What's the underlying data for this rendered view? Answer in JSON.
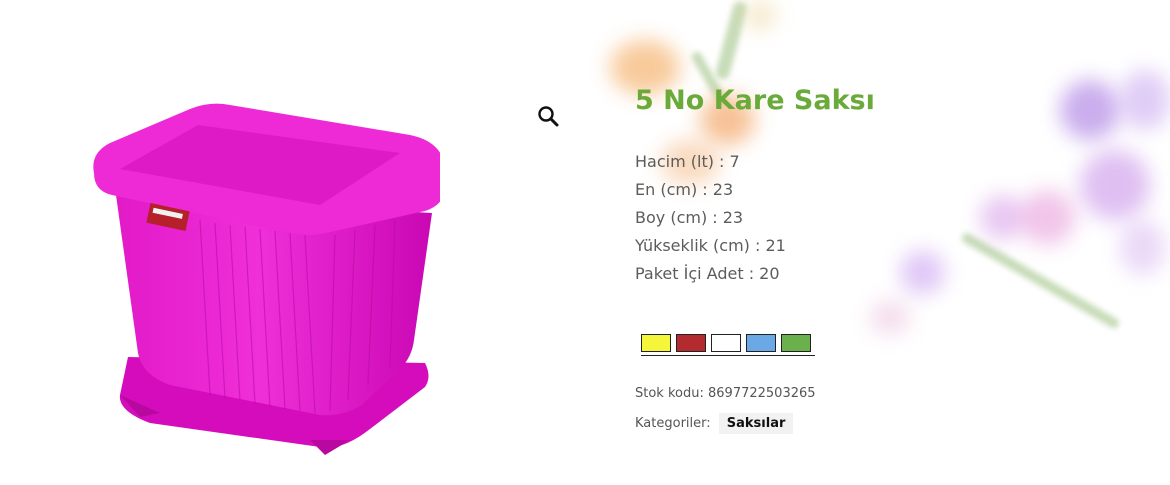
{
  "product": {
    "title": "5 No Kare Saksı",
    "specs": [
      "Hacim (lt) : 7",
      "En (cm) : 23",
      "Boy (cm) : 23",
      "Yükseklik (cm) : 21",
      "Paket İçi Adet : 20"
    ],
    "swatch_colors": [
      "#f5f53a",
      "#b32a2f",
      "#ffffff",
      "#6aa8e6",
      "#6ab04c"
    ],
    "stock_code_label": "Stok kodu:",
    "stock_code": "8697722503265",
    "categories_label": "Kategoriler:",
    "category": "Saksılar"
  },
  "colors": {
    "title": "#6aaa3a",
    "pot": "#e810c8"
  },
  "icons": {
    "zoom": "magnifier-icon"
  }
}
